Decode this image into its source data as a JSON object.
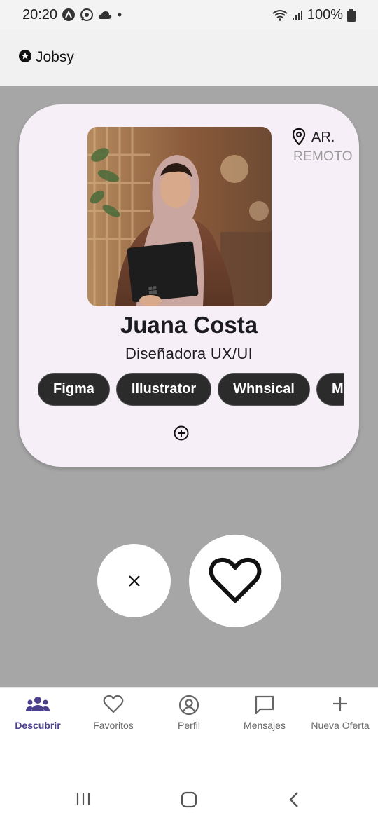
{
  "status_bar": {
    "time": "20:20",
    "battery": "100%"
  },
  "app_bar": {
    "title": "Jobsy",
    "logo_icon": "star-circle-icon"
  },
  "profile_card": {
    "name": "Juana Costa",
    "role": "Diseñadora UX/UI",
    "location": {
      "country": "AR.",
      "mode": "REMOTO"
    },
    "skills": [
      "Figma",
      "Illustrator",
      "Whnsical",
      "Mi"
    ],
    "more_icon": "add-circle-icon"
  },
  "actions": {
    "reject_icon": "close-icon",
    "like_icon": "heart-icon"
  },
  "bottom_nav": {
    "items": [
      {
        "label": "Descubrir",
        "icon": "people-icon",
        "active": true
      },
      {
        "label": "Favoritos",
        "icon": "heart-outline-icon",
        "active": false
      },
      {
        "label": "Perfil",
        "icon": "account-circle-icon",
        "active": false
      },
      {
        "label": "Mensajes",
        "icon": "chat-icon",
        "active": false
      },
      {
        "label": "Nueva Oferta",
        "icon": "plus-icon",
        "active": false
      }
    ]
  },
  "colors": {
    "background": "#a6a6a6",
    "card": "#f7eff7",
    "chip": "#2b2b2b",
    "accent": "#4a3f8c"
  }
}
